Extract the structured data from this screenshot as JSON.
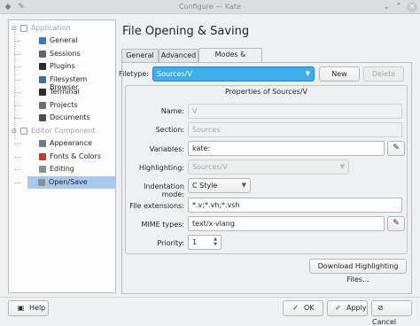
{
  "window": {
    "title": "Configure — Kate"
  },
  "sidebar": {
    "groups": [
      {
        "label": "Application",
        "items": [
          {
            "label": "General",
            "icon": "general-icon",
            "color": "#3c75c4"
          },
          {
            "label": "Sessions",
            "icon": "sessions-icon",
            "color": "#5a6570"
          },
          {
            "label": "Plugins",
            "icon": "plugins-icon",
            "color": "#2b2d30"
          },
          {
            "label": "Filesystem Browser",
            "icon": "folder-icon",
            "color": "#3c6ea8"
          },
          {
            "label": "Terminal",
            "icon": "terminal-icon",
            "color": "#2b2d30"
          },
          {
            "label": "Projects",
            "icon": "projects-icon",
            "color": "#6a6f75"
          },
          {
            "label": "Documents",
            "icon": "documents-icon",
            "color": "#4a4e54"
          }
        ]
      },
      {
        "label": "Editor Component",
        "items": [
          {
            "label": "Appearance",
            "icon": "appearance-icon",
            "color": "#6c7b8a"
          },
          {
            "label": "Fonts & Colors",
            "icon": "palette-icon",
            "color": "#c0392b"
          },
          {
            "label": "Editing",
            "icon": "editing-icon",
            "color": "#8a8f95"
          },
          {
            "label": "Open/Save",
            "icon": "open-save-icon",
            "color": "#8a8f95",
            "selected": true
          }
        ]
      }
    ]
  },
  "page": {
    "title": "File Opening & Saving"
  },
  "tabs": [
    "General",
    "Advanced",
    "Modes & Filetypes"
  ],
  "filetype": {
    "label": "Filetype:",
    "value": "Sources/V",
    "new_label": "New",
    "delete_label": "Delete"
  },
  "properties": {
    "title": "Properties of Sources/V",
    "name": {
      "label": "Name:",
      "value": "V"
    },
    "section": {
      "label": "Section:",
      "value": "Sources"
    },
    "variables": {
      "label": "Variables:",
      "value": "kate:"
    },
    "highlighting": {
      "label": "Highlighting:",
      "value": "Sources/V"
    },
    "indentation": {
      "label": "Indentation mode:",
      "value": "C Style"
    },
    "extensions": {
      "label": "File extensions:",
      "value": "*.v;*.vh;*.vsh"
    },
    "mime": {
      "label": "MIME types:",
      "value": "text/x-vlang"
    },
    "priority": {
      "label": "Priority:",
      "value": "1"
    }
  },
  "download_label": "Download Highlighting Files...",
  "footer": {
    "help": "Help",
    "ok": "OK",
    "apply": "Apply",
    "cancel": "Cancel"
  },
  "colors": {
    "accent": "#3daee9",
    "selection": "#aac8ee"
  }
}
